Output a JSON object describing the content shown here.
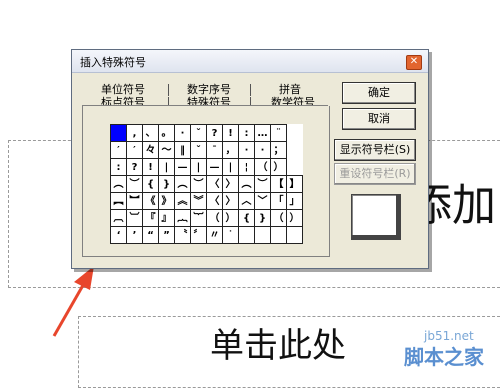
{
  "background": {
    "text_1": "添加",
    "text_2": "单击此处",
    "watermark_url": "jb51.net",
    "watermark_site": "脚本之家",
    "arrow_color": "#e8462c"
  },
  "dialog": {
    "title": "插入特殊符号",
    "close_label": "✕",
    "tabs_row1": [
      "单位符号",
      "数字序号",
      "拼音"
    ],
    "tabs_row2": [
      "标点符号",
      "特殊符号",
      "数学符号"
    ],
    "active_tab": "标点符号",
    "buttons": {
      "ok": "确定",
      "cancel": "取消",
      "show": "显示符号栏(S)",
      "reset": "重设符号栏(R)"
    },
    "symbol_rows": [
      [
        "",
        ",",
        "、",
        "。",
        "·",
        "ˇ",
        "?",
        "!",
        ":",
        "…",
        "¨"
      ],
      [
        "′",
        "′",
        "々",
        "～",
        "‖",
        "ˇ",
        "¯",
        "，",
        "·",
        "·",
        "；"
      ],
      [
        ":",
        "?",
        "!",
        "|",
        "—",
        "|",
        "—",
        "|",
        "¦",
        "（",
        "）"
      ],
      [
        "︵",
        "︶",
        "{",
        "}",
        "︵",
        "︶",
        "〈",
        "〉",
        "︵",
        "︶",
        "【",
        "】"
      ],
      [
        "︻",
        "︼",
        "《",
        "》",
        "︽",
        "︾",
        "〈",
        "〉",
        "︿",
        "﹀",
        "「",
        "」"
      ],
      [
        "︹",
        "︺",
        "『",
        "』",
        "︷",
        "︸",
        "（",
        "）",
        "{",
        "}",
        "（",
        "）"
      ],
      [
        "‘",
        "’",
        "“",
        "”",
        "〝",
        "〞",
        "〃",
        "˙",
        "",
        "",
        "",
        ""
      ]
    ]
  }
}
